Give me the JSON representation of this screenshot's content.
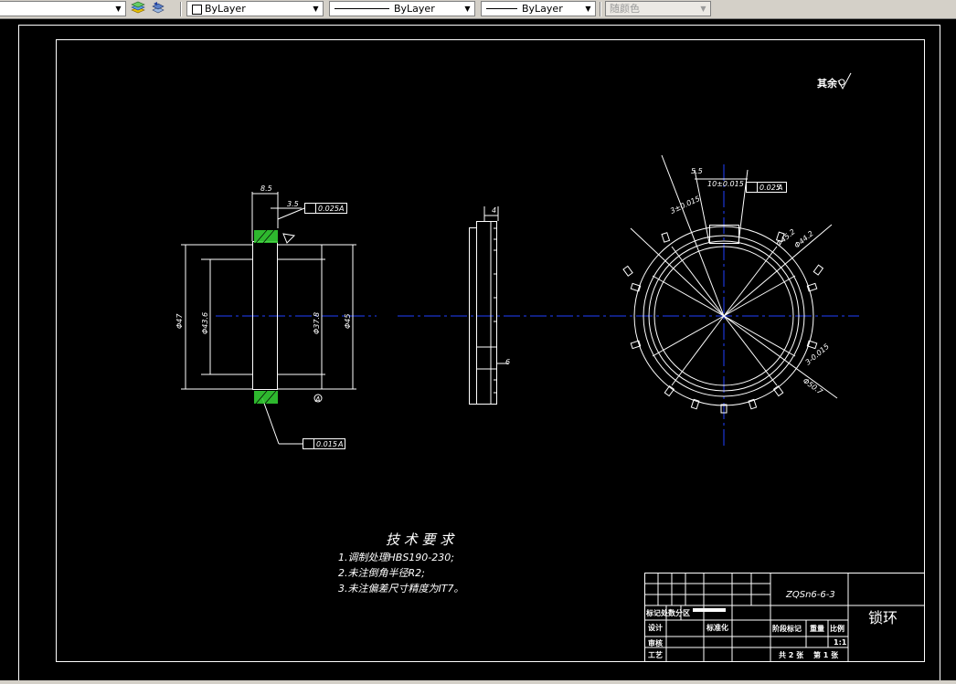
{
  "toolbar": {
    "color_combo": "ByLayer",
    "linetype_combo": "ByLayer",
    "lineweight_combo": "ByLayer",
    "plotstyle_combo": "随颜色"
  },
  "drawing": {
    "surface_finish_note": "其余",
    "tech_requirements": {
      "title": "技 术 要 求",
      "items": [
        "1.调制处理HBS190-230;",
        "2.未注倒角半径R2;",
        "3.未注偏差尺寸精度为IT7。"
      ]
    },
    "title_block": {
      "material": "ZQSn6-6-3",
      "part_name": "锁环",
      "row_labels": [
        "标记处数分",
        "区",
        "设计",
        "标准化",
        "审核",
        "工艺"
      ],
      "stage_labels": [
        "阶段标记",
        "重量",
        "比例"
      ],
      "scale": "1:1",
      "sheet_total": "共 2 张",
      "sheet_no": "第 1 张"
    },
    "dimensions": {
      "left_view": [
        "8.5",
        "3.5",
        "0.025",
        "A",
        "Φ47",
        "Φ43.6",
        "Φ37.8",
        "Φ45",
        "A",
        "0.015",
        "A"
      ],
      "middle_view": [
        "4",
        "6"
      ],
      "right_view": [
        "5.5",
        "10±0.015",
        "0.025",
        "A",
        "3±0.015",
        "Φ45.2",
        "Φ44.2",
        "3-0.015",
        "Φ50.7"
      ]
    }
  },
  "colors": {
    "toolbar_bg": "#d4d0c8",
    "canvas_bg": "#000000",
    "line_white": "#ffffff",
    "center_line_blue": "#1f3fff",
    "hatch_green": "#33cc33"
  }
}
